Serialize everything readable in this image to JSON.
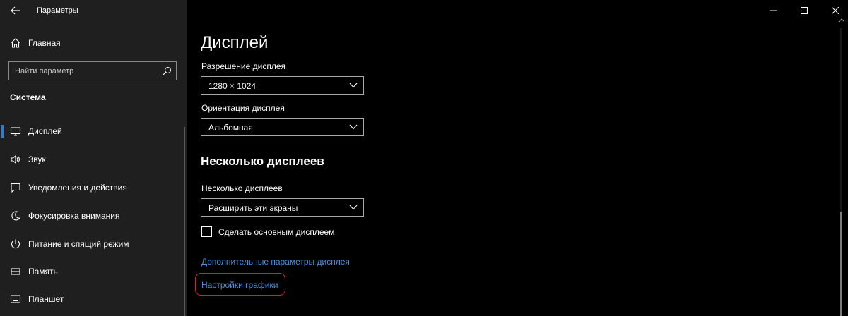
{
  "window": {
    "title": "Параметры",
    "controls": [
      "minimize",
      "maximize",
      "close"
    ]
  },
  "sidebar": {
    "home_label": "Главная",
    "search": {
      "placeholder": "Найти параметр",
      "value": ""
    },
    "section_header": "Система",
    "items": [
      {
        "label": "Дисплей",
        "icon": "monitor-icon",
        "active": true
      },
      {
        "label": "Звук",
        "icon": "speaker-icon",
        "active": false
      },
      {
        "label": "Уведомления и действия",
        "icon": "notification-icon",
        "active": false
      },
      {
        "label": "Фокусировка внимания",
        "icon": "moon-icon",
        "active": false
      },
      {
        "label": "Питание и спящий режим",
        "icon": "power-icon",
        "active": false
      },
      {
        "label": "Память",
        "icon": "storage-icon",
        "active": false
      },
      {
        "label": "Планшет",
        "icon": "tablet-icon",
        "active": false
      }
    ]
  },
  "main": {
    "title": "Дисплей",
    "resolution": {
      "label": "Разрешение дисплея",
      "value": "1280 × 1024"
    },
    "orientation": {
      "label": "Ориентация дисплея",
      "value": "Альбомная"
    },
    "multi_section_title": "Несколько дисплеев",
    "multi": {
      "label": "Несколько дисплеев",
      "value": "Расширить эти экраны"
    },
    "primary_checkbox": {
      "label": "Сделать основным дисплеем",
      "checked": false
    },
    "links": {
      "advanced": "Дополнительные параметры дисплея",
      "graphics": "Настройки графики"
    }
  },
  "colors": {
    "accent": "#2d7dd2",
    "link": "#4a90d9",
    "highlight": "#e11d2a",
    "sidebar_bg": "#1f1f1f",
    "main_bg": "#000000"
  }
}
